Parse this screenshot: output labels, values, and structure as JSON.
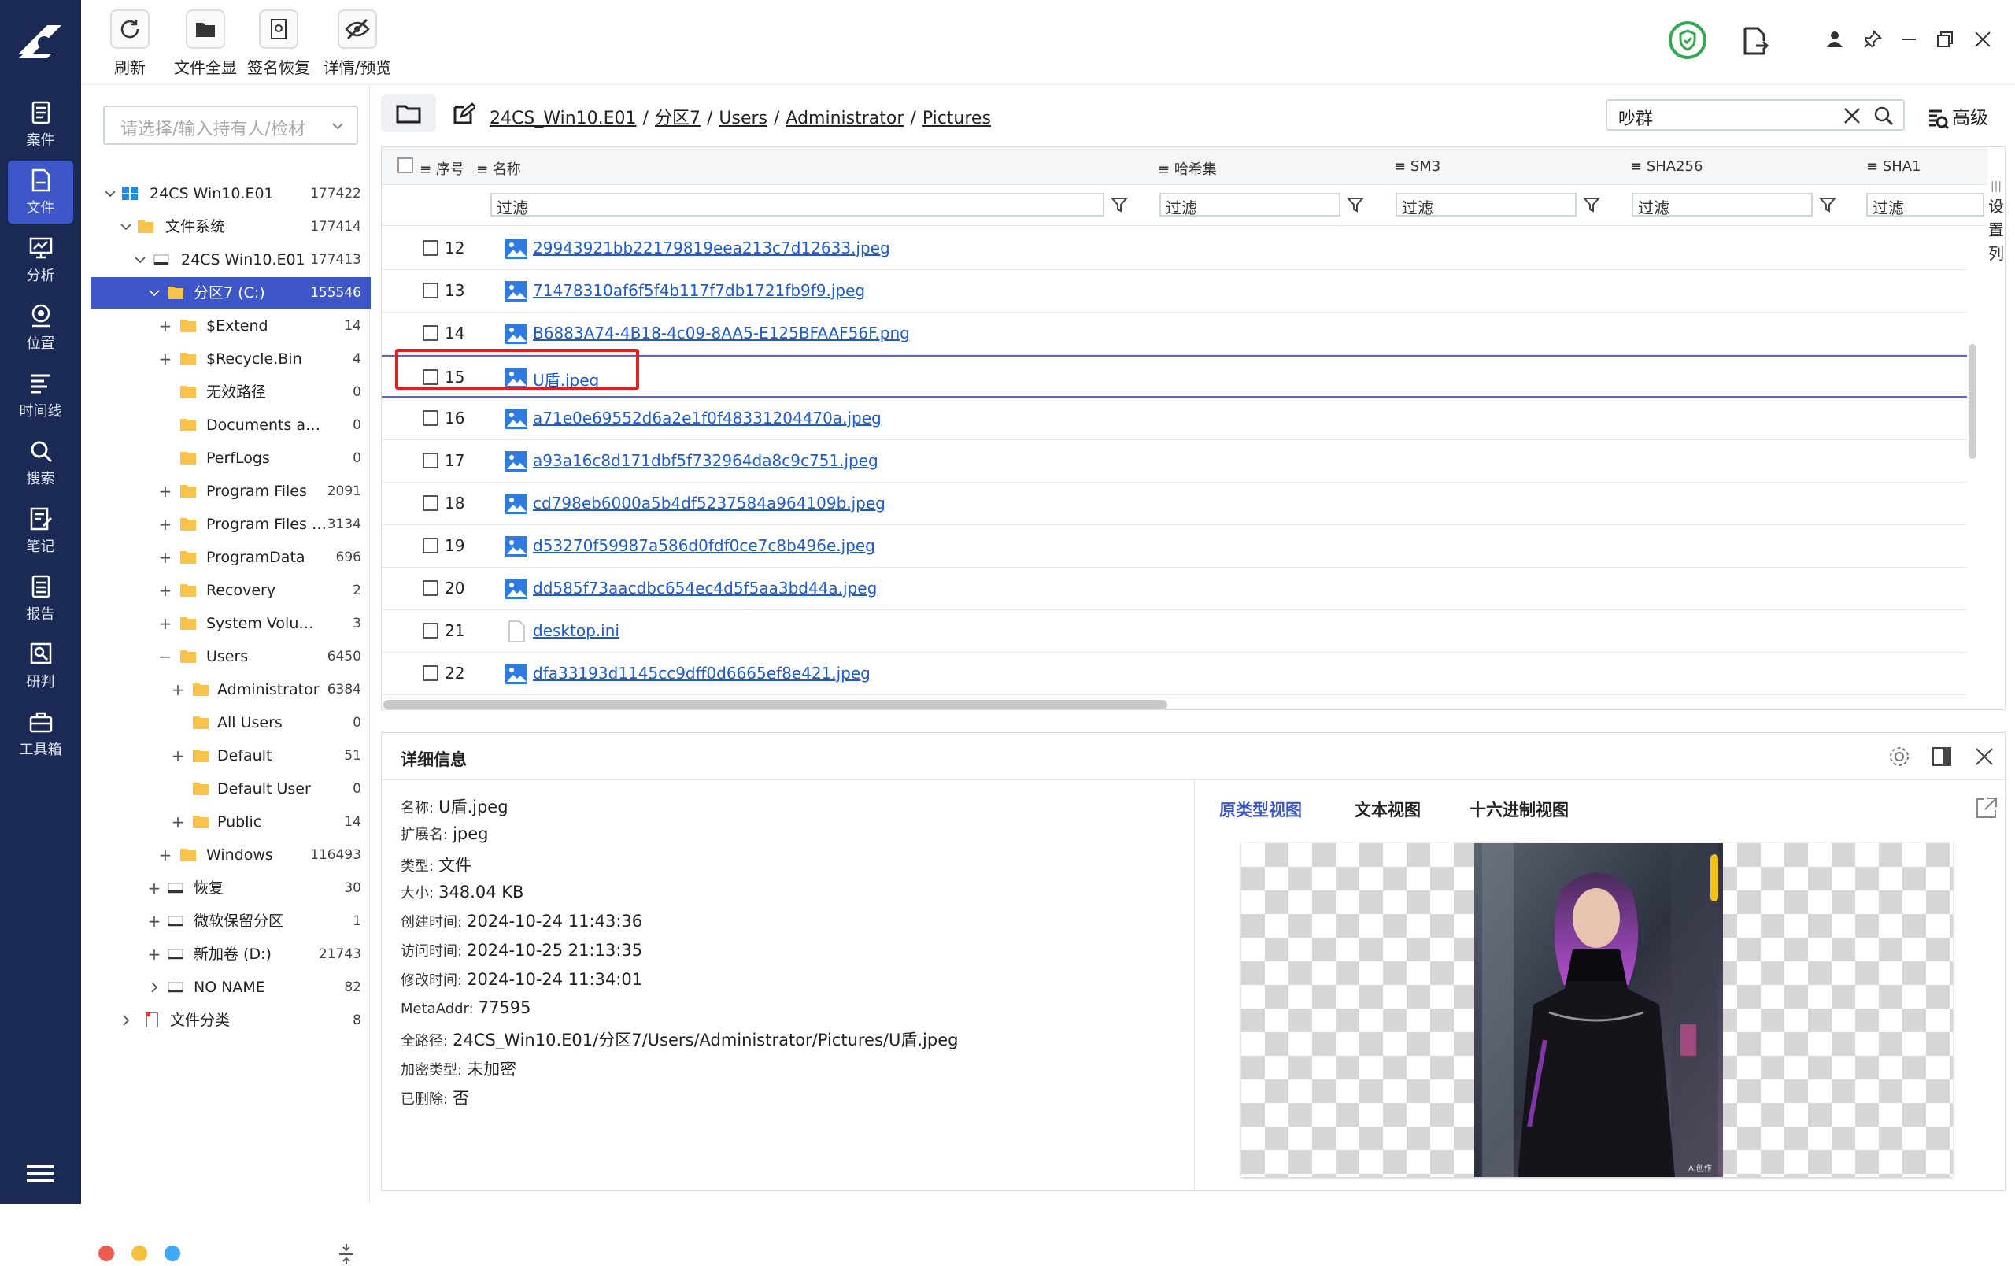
{
  "nav": [
    {
      "id": "case",
      "label": "案件"
    },
    {
      "id": "file",
      "label": "文件",
      "active": true
    },
    {
      "id": "analysis",
      "label": "分析"
    },
    {
      "id": "location",
      "label": "位置"
    },
    {
      "id": "timeline",
      "label": "时间线"
    },
    {
      "id": "search",
      "label": "搜索"
    },
    {
      "id": "notes",
      "label": "笔记"
    },
    {
      "id": "report",
      "label": "报告"
    },
    {
      "id": "judge",
      "label": "研判"
    },
    {
      "id": "toolbox",
      "label": "工具箱"
    }
  ],
  "toolbar": {
    "refresh": "刷新",
    "show_all": "文件全显",
    "sig_recover": "签名恢复",
    "detail_preview": "详情/预览"
  },
  "left": {
    "owner_placeholder": "请选择/输入持有人/检材",
    "tree": [
      {
        "label": "24CS Win10.E01",
        "count": "177422"
      },
      {
        "label": "文件系统",
        "count": "177414"
      },
      {
        "label": "24CS Win10.E01",
        "count": "177413"
      },
      {
        "label": "分区7 (C:)",
        "count": "155546"
      },
      {
        "label": "$Extend",
        "count": "14"
      },
      {
        "label": "$Recycle.Bin",
        "count": "4"
      },
      {
        "label": "无效路径",
        "count": "0"
      },
      {
        "label": "Documents and S...",
        "count": "0"
      },
      {
        "label": "PerfLogs",
        "count": "0"
      },
      {
        "label": "Program Files",
        "count": "2091"
      },
      {
        "label": "Program Files (...",
        "count": "3134"
      },
      {
        "label": "ProgramData",
        "count": "696"
      },
      {
        "label": "Recovery",
        "count": "2"
      },
      {
        "label": "System Volume In...",
        "count": "3"
      },
      {
        "label": "Users",
        "count": "6450"
      },
      {
        "label": "Administrator",
        "count": "6384"
      },
      {
        "label": "All Users",
        "count": "0"
      },
      {
        "label": "Default",
        "count": "51"
      },
      {
        "label": "Default User",
        "count": "0"
      },
      {
        "label": "Public",
        "count": "14"
      },
      {
        "label": "Windows",
        "count": "116493"
      },
      {
        "label": "恢复",
        "count": "30"
      },
      {
        "label": "微软保留分区",
        "count": "1"
      },
      {
        "label": "新加卷 (D:)",
        "count": "21743"
      },
      {
        "label": "NO NAME",
        "count": "82"
      },
      {
        "label": "文件分类",
        "count": "8"
      }
    ]
  },
  "path": {
    "crumbs": [
      "24CS_Win10.E01",
      "分区7",
      "Users",
      "Administrator",
      "Pictures"
    ],
    "sep": "/"
  },
  "search": {
    "value": "吵群",
    "advanced": "高级"
  },
  "table": {
    "columns": {
      "no": "序号",
      "name": "名称",
      "hash": "哈希集",
      "sm3": "SM3",
      "sha256": "SHA256",
      "sha1": "SHA1"
    },
    "filter_placeholder": "过滤",
    "set_columns": "设置列",
    "rows": [
      {
        "no": "12",
        "name": "29943921bb22179819eea213c7d12633.jpeg",
        "type": "image"
      },
      {
        "no": "13",
        "name": "71478310af6f5f4b117f7db1721fb9f9.jpeg",
        "type": "image"
      },
      {
        "no": "14",
        "name": "B6883A74-4B18-4c09-8AA5-E125BFAAF56F.png",
        "type": "image"
      },
      {
        "no": "15",
        "name": "U盾.jpeg",
        "type": "image",
        "highlight": true
      },
      {
        "no": "16",
        "name": "a71e0e69552d6a2e1f0f48331204470a.jpeg",
        "type": "image"
      },
      {
        "no": "17",
        "name": "a93a16c8d171dbf5f732964da8c9c751.jpeg",
        "type": "image"
      },
      {
        "no": "18",
        "name": "cd798eb6000a5b4df5237584a964109b.jpeg",
        "type": "image"
      },
      {
        "no": "19",
        "name": "d53270f59987a586d0fdf0ce7c8b496e.jpeg",
        "type": "image"
      },
      {
        "no": "20",
        "name": "dd585f73aacdbc654ec4d5f5aa3bd44a.jpeg",
        "type": "image"
      },
      {
        "no": "21",
        "name": "desktop.ini",
        "type": "file"
      },
      {
        "no": "22",
        "name": "dfa33193d1145cc9dff0d6665ef8e421.jpeg",
        "type": "image"
      }
    ]
  },
  "detail": {
    "title": "详细信息",
    "props": [
      {
        "k": "名称:",
        "v": "U盾.jpeg"
      },
      {
        "k": "扩展名:",
        "v": "jpeg"
      },
      {
        "k": "类型:",
        "v": "文件"
      },
      {
        "k": "大小:",
        "v": "348.04 KB"
      },
      {
        "k": "创建时间:",
        "v": "2024-10-24 11:43:36"
      },
      {
        "k": "访问时间:",
        "v": "2024-10-25 21:13:35"
      },
      {
        "k": "修改时间:",
        "v": "2024-10-24 11:34:01"
      },
      {
        "k": "MetaAddr:",
        "v": "77595"
      },
      {
        "k": "全路径:",
        "v": "24CS_Win10.E01/分区7/Users/Administrator/Pictures/U盾.jpeg"
      },
      {
        "k": "加密类型:",
        "v": "未加密"
      },
      {
        "k": "已删除:",
        "v": "否"
      }
    ],
    "tabs": [
      "原类型视图",
      "文本视图",
      "十六进制视图"
    ],
    "watermark": "AI创作"
  },
  "colors": {
    "rail": "#1b2a55",
    "accent": "#3d56c8",
    "link": "#1a5bd6",
    "highlight_box": "#e0201a",
    "folder": "#f7c34a"
  }
}
